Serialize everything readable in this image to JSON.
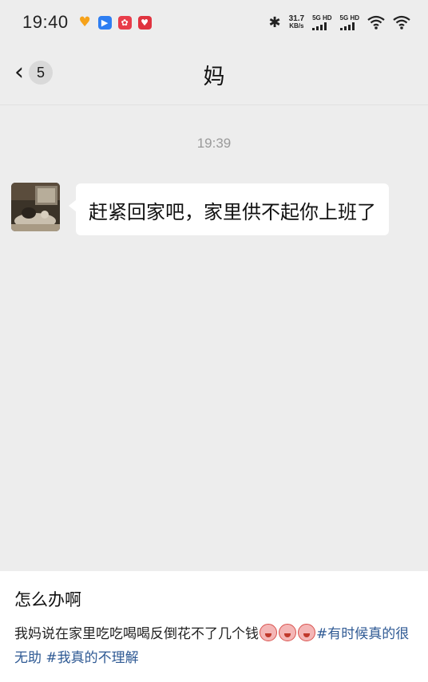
{
  "status_bar": {
    "time": "19:40",
    "app_icons": [
      "heart-icon",
      "play-icon",
      "flower-icon",
      "redheart-icon"
    ],
    "net_speed_value": "31.7",
    "net_speed_unit": "KB/s",
    "signal1_label": "5G HD",
    "signal2_label": "5G HD"
  },
  "header": {
    "back_badge": "5",
    "title": "妈"
  },
  "chat": {
    "timestamp": "19:39",
    "messages": [
      {
        "sender": "mom",
        "text": "赶紧回家吧，家里供不起你上班了"
      }
    ]
  },
  "caption": {
    "title": "怎么办啊",
    "body_text": "我妈说在家里吃吃喝喝反倒花不了几个钱",
    "hashtags": [
      "#有时候真的很无助",
      "#我真的不理解"
    ]
  },
  "colors": {
    "background": "#ededed",
    "bubble": "#ffffff",
    "hashtag": "#2f5a94"
  }
}
